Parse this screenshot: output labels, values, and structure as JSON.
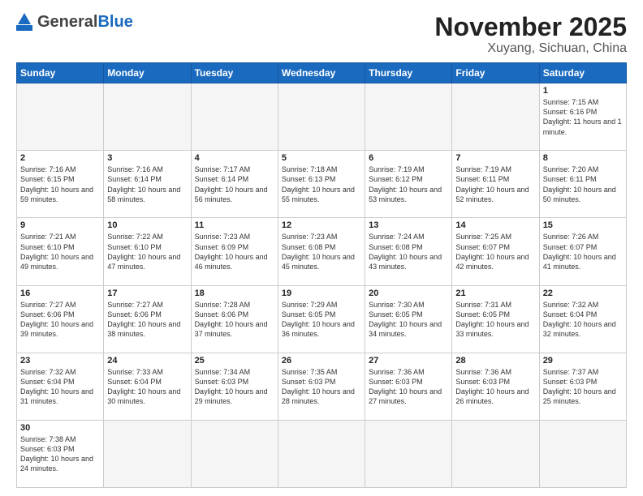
{
  "header": {
    "title": "November 2025",
    "subtitle": "Xuyang, Sichuan, China",
    "logo_general": "General",
    "logo_blue": "Blue"
  },
  "columns": [
    "Sunday",
    "Monday",
    "Tuesday",
    "Wednesday",
    "Thursday",
    "Friday",
    "Saturday"
  ],
  "weeks": [
    [
      {
        "day": "",
        "info": "",
        "empty": true
      },
      {
        "day": "",
        "info": "",
        "empty": true
      },
      {
        "day": "",
        "info": "",
        "empty": true
      },
      {
        "day": "",
        "info": "",
        "empty": true
      },
      {
        "day": "",
        "info": "",
        "empty": true
      },
      {
        "day": "",
        "info": "",
        "empty": true
      },
      {
        "day": "1",
        "info": "Sunrise: 7:15 AM\nSunset: 6:16 PM\nDaylight: 11 hours\nand 1 minute."
      }
    ],
    [
      {
        "day": "2",
        "info": "Sunrise: 7:16 AM\nSunset: 6:15 PM\nDaylight: 10 hours\nand 59 minutes."
      },
      {
        "day": "3",
        "info": "Sunrise: 7:16 AM\nSunset: 6:14 PM\nDaylight: 10 hours\nand 58 minutes."
      },
      {
        "day": "4",
        "info": "Sunrise: 7:17 AM\nSunset: 6:14 PM\nDaylight: 10 hours\nand 56 minutes."
      },
      {
        "day": "5",
        "info": "Sunrise: 7:18 AM\nSunset: 6:13 PM\nDaylight: 10 hours\nand 55 minutes."
      },
      {
        "day": "6",
        "info": "Sunrise: 7:19 AM\nSunset: 6:12 PM\nDaylight: 10 hours\nand 53 minutes."
      },
      {
        "day": "7",
        "info": "Sunrise: 7:19 AM\nSunset: 6:11 PM\nDaylight: 10 hours\nand 52 minutes."
      },
      {
        "day": "8",
        "info": "Sunrise: 7:20 AM\nSunset: 6:11 PM\nDaylight: 10 hours\nand 50 minutes."
      }
    ],
    [
      {
        "day": "9",
        "info": "Sunrise: 7:21 AM\nSunset: 6:10 PM\nDaylight: 10 hours\nand 49 minutes."
      },
      {
        "day": "10",
        "info": "Sunrise: 7:22 AM\nSunset: 6:10 PM\nDaylight: 10 hours\nand 47 minutes."
      },
      {
        "day": "11",
        "info": "Sunrise: 7:23 AM\nSunset: 6:09 PM\nDaylight: 10 hours\nand 46 minutes."
      },
      {
        "day": "12",
        "info": "Sunrise: 7:23 AM\nSunset: 6:08 PM\nDaylight: 10 hours\nand 45 minutes."
      },
      {
        "day": "13",
        "info": "Sunrise: 7:24 AM\nSunset: 6:08 PM\nDaylight: 10 hours\nand 43 minutes."
      },
      {
        "day": "14",
        "info": "Sunrise: 7:25 AM\nSunset: 6:07 PM\nDaylight: 10 hours\nand 42 minutes."
      },
      {
        "day": "15",
        "info": "Sunrise: 7:26 AM\nSunset: 6:07 PM\nDaylight: 10 hours\nand 41 minutes."
      }
    ],
    [
      {
        "day": "16",
        "info": "Sunrise: 7:27 AM\nSunset: 6:06 PM\nDaylight: 10 hours\nand 39 minutes."
      },
      {
        "day": "17",
        "info": "Sunrise: 7:27 AM\nSunset: 6:06 PM\nDaylight: 10 hours\nand 38 minutes."
      },
      {
        "day": "18",
        "info": "Sunrise: 7:28 AM\nSunset: 6:06 PM\nDaylight: 10 hours\nand 37 minutes."
      },
      {
        "day": "19",
        "info": "Sunrise: 7:29 AM\nSunset: 6:05 PM\nDaylight: 10 hours\nand 36 minutes."
      },
      {
        "day": "20",
        "info": "Sunrise: 7:30 AM\nSunset: 6:05 PM\nDaylight: 10 hours\nand 34 minutes."
      },
      {
        "day": "21",
        "info": "Sunrise: 7:31 AM\nSunset: 6:05 PM\nDaylight: 10 hours\nand 33 minutes."
      },
      {
        "day": "22",
        "info": "Sunrise: 7:32 AM\nSunset: 6:04 PM\nDaylight: 10 hours\nand 32 minutes."
      }
    ],
    [
      {
        "day": "23",
        "info": "Sunrise: 7:32 AM\nSunset: 6:04 PM\nDaylight: 10 hours\nand 31 minutes."
      },
      {
        "day": "24",
        "info": "Sunrise: 7:33 AM\nSunset: 6:04 PM\nDaylight: 10 hours\nand 30 minutes."
      },
      {
        "day": "25",
        "info": "Sunrise: 7:34 AM\nSunset: 6:03 PM\nDaylight: 10 hours\nand 29 minutes."
      },
      {
        "day": "26",
        "info": "Sunrise: 7:35 AM\nSunset: 6:03 PM\nDaylight: 10 hours\nand 28 minutes."
      },
      {
        "day": "27",
        "info": "Sunrise: 7:36 AM\nSunset: 6:03 PM\nDaylight: 10 hours\nand 27 minutes."
      },
      {
        "day": "28",
        "info": "Sunrise: 7:36 AM\nSunset: 6:03 PM\nDaylight: 10 hours\nand 26 minutes."
      },
      {
        "day": "29",
        "info": "Sunrise: 7:37 AM\nSunset: 6:03 PM\nDaylight: 10 hours\nand 25 minutes."
      }
    ],
    [
      {
        "day": "30",
        "info": "Sunrise: 7:38 AM\nSunset: 6:03 PM\nDaylight: 10 hours\nand 24 minutes."
      },
      {
        "day": "",
        "info": "",
        "empty": true
      },
      {
        "day": "",
        "info": "",
        "empty": true
      },
      {
        "day": "",
        "info": "",
        "empty": true
      },
      {
        "day": "",
        "info": "",
        "empty": true
      },
      {
        "day": "",
        "info": "",
        "empty": true
      },
      {
        "day": "",
        "info": "",
        "empty": true
      }
    ]
  ]
}
